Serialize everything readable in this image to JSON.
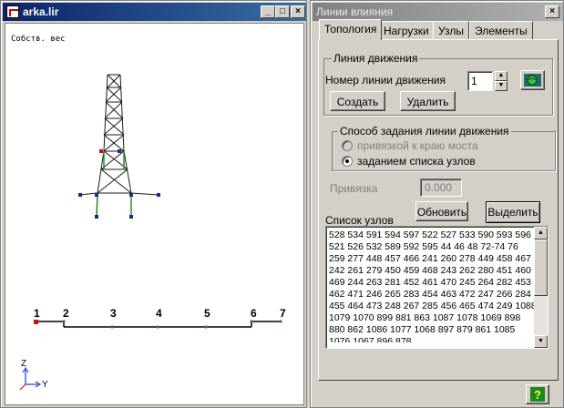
{
  "left_window": {
    "title": "arka.lir",
    "buttons": {
      "minimize": "_",
      "maximize": "□",
      "close": "×"
    },
    "canvas_caption": "Собств. вес",
    "node_labels": [
      "1",
      "2",
      "3",
      "4",
      "5",
      "6",
      "7"
    ],
    "axes": {
      "z": "Z",
      "y": "Y"
    }
  },
  "dialog": {
    "title": "Линии влияния",
    "close": "×",
    "tabs": [
      "Топология",
      "Нагрузки",
      "Узлы",
      "Элементы"
    ],
    "active_tab": "Топология",
    "motion_group": {
      "legend": "Линия движения",
      "number_label": "Номер линии движения",
      "number_value": "1",
      "create_button": "Создать",
      "delete_button": "Удалить"
    },
    "method_group": {
      "legend": "Способ задания линии движения",
      "option_edge": "привязкой к краю моста",
      "option_list": "заданием списка узлов",
      "selected": "option_list"
    },
    "binding_label": "Привязка",
    "binding_value": "0.000",
    "node_list_label": "Список узлов",
    "refresh_button": "Обновить",
    "select_button": "Выделить",
    "node_list": "528 534 591 594 597 522 527 533 590 593 596 521 526 532 589 592 595 44 46 48 72-74 76 259 277 448 457 466 241 260 278 449 458 467 242 261 279 450 459 468 243 262 280 451 460 469 244 263 281 452 461 470 245 264 282 453 462 471 246 265 283 454 463 472 247 266 284 455 464 473 248 267 285 456 465 474 249 1088 1079 1070 899 881 863 1087 1078 1069 898 880 862 1086 1077 1068 897 879 861 1085 1076 1067 896 878",
    "help_button": "?"
  },
  "colors": {
    "active_title": "#0a246a",
    "inactive_title": "#808080",
    "structure_green": "#1a8a1a",
    "node_blue": "#1a2a8a",
    "node_red": "#d01010"
  }
}
